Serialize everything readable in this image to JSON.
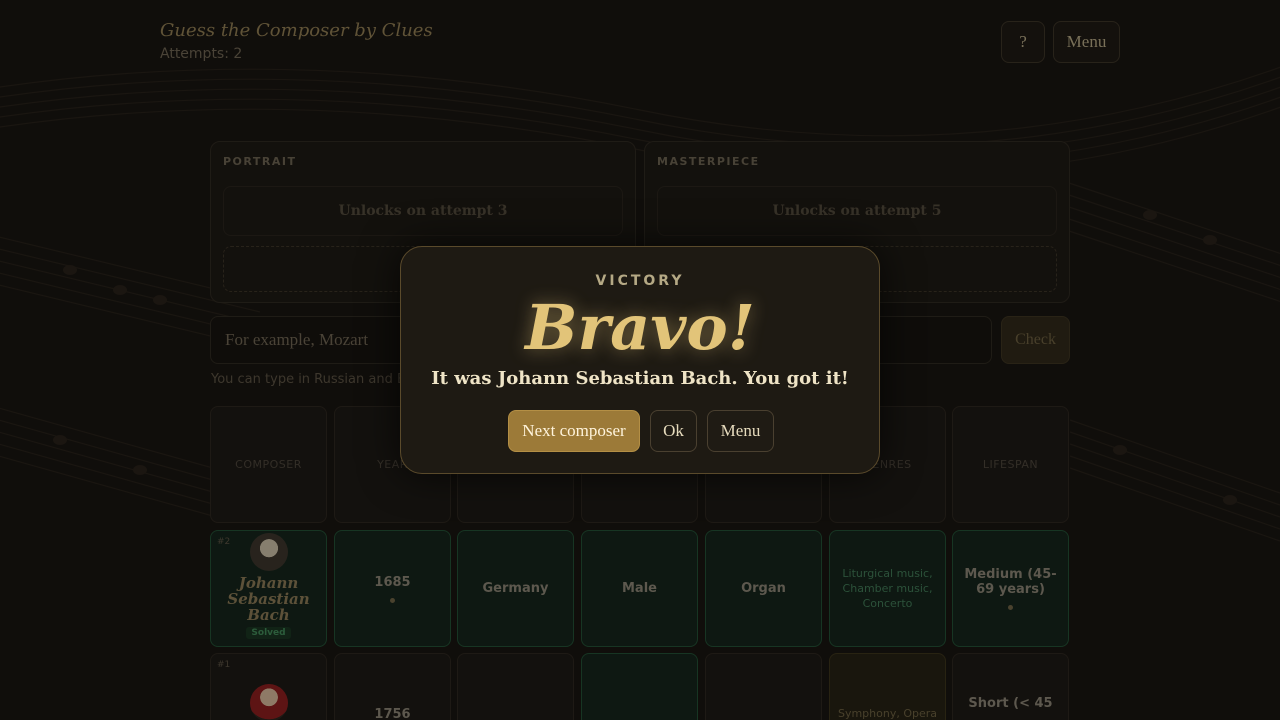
{
  "header": {
    "title": "Guess the Composer by Clues",
    "attempts": "Attempts: 2",
    "help_label": "?",
    "menu_label": "Menu"
  },
  "clues": {
    "portrait": {
      "label": "PORTRAIT",
      "status": "Unlocks on attempt 3"
    },
    "masterpiece": {
      "label": "MASTERPIECE",
      "status": "Unlocks on attempt 5"
    }
  },
  "guess": {
    "placeholder": "For example, Mozart",
    "check_label": "Check",
    "hint": "You can type in Russian and En"
  },
  "columns": [
    "COMPOSER",
    "YEAR",
    "",
    "",
    "",
    "GENRES",
    "LIFESPAN"
  ],
  "rows": [
    {
      "number": "#2",
      "composer": "Johann Sebastian Bach",
      "badge": "Solved",
      "year": "1685",
      "country": "Germany",
      "gender": "Male",
      "instrument": "Organ",
      "genres": "Liturgical music, Chamber music, Concerto",
      "lifespan": "Medium (45-69 years)"
    },
    {
      "number": "#1",
      "year": "1756",
      "genres": "Symphony, Opera",
      "lifespan": "Short (< 45"
    }
  ],
  "modal": {
    "label": "VICTORY",
    "headline": "Bravo!",
    "message": "It was Johann Sebastian Bach. You got it!",
    "next_label": "Next composer",
    "ok_label": "Ok",
    "menu_label": "Menu"
  }
}
